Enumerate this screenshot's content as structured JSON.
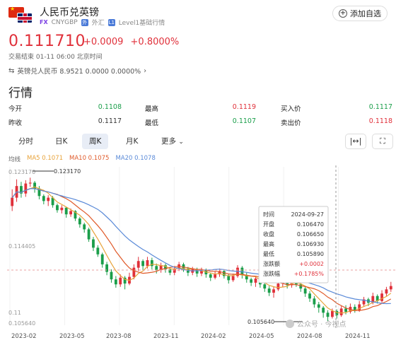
{
  "header": {
    "title": "人民币兑英镑",
    "badge": "FX",
    "code": "CNYGBP",
    "market_icon": "外",
    "market": "外汇",
    "level_icon": "L1",
    "level": "Level1基础行情",
    "add_watchlist": "添加自选"
  },
  "quote": {
    "price": "0.111710",
    "change": "+0.0009",
    "change_pct": "+0.8000%",
    "status": "交易结束 01-11 06:00 北京时间",
    "conversion": "英镑兑人民币 8.9521 0.0000 0.0000%"
  },
  "section_title": "行情",
  "stats": [
    {
      "label": "今开",
      "value": "0.1108",
      "color": "green"
    },
    {
      "label": "最高",
      "value": "0.1119",
      "color": "red"
    },
    {
      "label": "买入价",
      "value": "0.1117",
      "color": "green"
    },
    {
      "label": "昨收",
      "value": "0.1117",
      "color": "neutral"
    },
    {
      "label": "最低",
      "value": "0.1107",
      "color": "green"
    },
    {
      "label": "卖出价",
      "value": "0.1118",
      "color": "red"
    }
  ],
  "tabs": [
    "分时",
    "日K",
    "周K",
    "月K",
    "更多"
  ],
  "active_tab": "周K",
  "ma": {
    "label": "均线",
    "ma5": "MA5 0.1071",
    "ma10": "MA10 0.1075",
    "ma20": "MA20 0.1078"
  },
  "colors": {
    "up": "#e0303a",
    "down": "#1a9e4a",
    "ma5": "#e8a33a",
    "ma10": "#e05a2a",
    "ma20": "#5a8ad8"
  },
  "chart_data": {
    "type": "candlestick",
    "y_ticks": [
      "0.123170",
      "0.114405",
      "0.11",
      "0.105640"
    ],
    "annotations": {
      "high": "0.123170",
      "low": "0.105640"
    },
    "x_ticks": [
      "2023-02",
      "2023-05",
      "2023-08",
      "2023-11",
      "2024-02",
      "2024-05",
      "2024-08",
      "2024-11"
    ],
    "ylim": [
      0.1055,
      0.1245
    ],
    "candles": [
      {
        "o": 0.1198,
        "c": 0.1208,
        "h": 0.1218,
        "l": 0.1192
      },
      {
        "o": 0.1208,
        "c": 0.1222,
        "h": 0.123,
        "l": 0.1203
      },
      {
        "o": 0.1222,
        "c": 0.1213,
        "h": 0.1227,
        "l": 0.1208
      },
      {
        "o": 0.1213,
        "c": 0.1225,
        "h": 0.1229,
        "l": 0.1209
      },
      {
        "o": 0.1225,
        "c": 0.1226,
        "h": 0.1232,
        "l": 0.1221
      },
      {
        "o": 0.1226,
        "c": 0.1219,
        "h": 0.1228,
        "l": 0.1214
      },
      {
        "o": 0.1219,
        "c": 0.121,
        "h": 0.1222,
        "l": 0.1206
      },
      {
        "o": 0.121,
        "c": 0.1204,
        "h": 0.1212,
        "l": 0.12
      },
      {
        "o": 0.1204,
        "c": 0.1208,
        "h": 0.1211,
        "l": 0.1198
      },
      {
        "o": 0.1208,
        "c": 0.1199,
        "h": 0.121,
        "l": 0.1196
      },
      {
        "o": 0.1199,
        "c": 0.1193,
        "h": 0.1201,
        "l": 0.119
      },
      {
        "o": 0.1193,
        "c": 0.1196,
        "h": 0.1199,
        "l": 0.1189
      },
      {
        "o": 0.1196,
        "c": 0.1188,
        "h": 0.1197,
        "l": 0.1184
      },
      {
        "o": 0.1188,
        "c": 0.1192,
        "h": 0.1195,
        "l": 0.1185
      },
      {
        "o": 0.1192,
        "c": 0.1183,
        "h": 0.1193,
        "l": 0.118
      },
      {
        "o": 0.1183,
        "c": 0.1176,
        "h": 0.1185,
        "l": 0.1172
      },
      {
        "o": 0.1176,
        "c": 0.117,
        "h": 0.1178,
        "l": 0.1166
      },
      {
        "o": 0.117,
        "c": 0.1158,
        "h": 0.1172,
        "l": 0.1155
      },
      {
        "o": 0.1158,
        "c": 0.1148,
        "h": 0.1161,
        "l": 0.1144
      },
      {
        "o": 0.1148,
        "c": 0.114,
        "h": 0.1151,
        "l": 0.1137
      },
      {
        "o": 0.114,
        "c": 0.1128,
        "h": 0.1142,
        "l": 0.1124
      },
      {
        "o": 0.1128,
        "c": 0.1119,
        "h": 0.1131,
        "l": 0.1115
      },
      {
        "o": 0.1119,
        "c": 0.111,
        "h": 0.1122,
        "l": 0.1106
      },
      {
        "o": 0.111,
        "c": 0.1104,
        "h": 0.1114,
        "l": 0.11
      },
      {
        "o": 0.1104,
        "c": 0.1112,
        "h": 0.1116,
        "l": 0.1101
      },
      {
        "o": 0.1112,
        "c": 0.1105,
        "h": 0.1114,
        "l": 0.1098
      },
      {
        "o": 0.1105,
        "c": 0.1113,
        "h": 0.1118,
        "l": 0.1103
      },
      {
        "o": 0.1113,
        "c": 0.1124,
        "h": 0.1128,
        "l": 0.111
      },
      {
        "o": 0.1124,
        "c": 0.1132,
        "h": 0.1137,
        "l": 0.112
      },
      {
        "o": 0.1132,
        "c": 0.1126,
        "h": 0.1134,
        "l": 0.1121
      },
      {
        "o": 0.1126,
        "c": 0.1133,
        "h": 0.1137,
        "l": 0.1123
      },
      {
        "o": 0.1133,
        "c": 0.1126,
        "h": 0.1136,
        "l": 0.1122
      },
      {
        "o": 0.1126,
        "c": 0.1121,
        "h": 0.1129,
        "l": 0.1117
      },
      {
        "o": 0.1121,
        "c": 0.1127,
        "h": 0.113,
        "l": 0.1118
      },
      {
        "o": 0.1127,
        "c": 0.1122,
        "h": 0.1129,
        "l": 0.1118
      },
      {
        "o": 0.1122,
        "c": 0.1118,
        "h": 0.1125,
        "l": 0.1115
      },
      {
        "o": 0.1118,
        "c": 0.1123,
        "h": 0.1126,
        "l": 0.1115
      },
      {
        "o": 0.1123,
        "c": 0.1128,
        "h": 0.1131,
        "l": 0.112
      },
      {
        "o": 0.1128,
        "c": 0.1123,
        "h": 0.113,
        "l": 0.1119
      },
      {
        "o": 0.1123,
        "c": 0.1118,
        "h": 0.1125,
        "l": 0.1114
      },
      {
        "o": 0.1118,
        "c": 0.1122,
        "h": 0.1125,
        "l": 0.1115
      },
      {
        "o": 0.1122,
        "c": 0.1117,
        "h": 0.1124,
        "l": 0.1113
      },
      {
        "o": 0.1117,
        "c": 0.1121,
        "h": 0.1124,
        "l": 0.1114
      },
      {
        "o": 0.1121,
        "c": 0.1116,
        "h": 0.1123,
        "l": 0.1112
      },
      {
        "o": 0.1116,
        "c": 0.1112,
        "h": 0.1118,
        "l": 0.1108
      },
      {
        "o": 0.1112,
        "c": 0.1116,
        "h": 0.112,
        "l": 0.111
      },
      {
        "o": 0.1116,
        "c": 0.112,
        "h": 0.1123,
        "l": 0.1113
      },
      {
        "o": 0.112,
        "c": 0.1114,
        "h": 0.1122,
        "l": 0.1111
      },
      {
        "o": 0.1114,
        "c": 0.1109,
        "h": 0.1116,
        "l": 0.1105
      },
      {
        "o": 0.1109,
        "c": 0.1114,
        "h": 0.1117,
        "l": 0.1107
      },
      {
        "o": 0.1114,
        "c": 0.1124,
        "h": 0.1127,
        "l": 0.1112
      },
      {
        "o": 0.1124,
        "c": 0.1115,
        "h": 0.1126,
        "l": 0.1111
      },
      {
        "o": 0.1115,
        "c": 0.111,
        "h": 0.1118,
        "l": 0.1106
      },
      {
        "o": 0.111,
        "c": 0.1106,
        "h": 0.1112,
        "l": 0.1102
      },
      {
        "o": 0.1106,
        "c": 0.1111,
        "h": 0.1114,
        "l": 0.1101
      },
      {
        "o": 0.1111,
        "c": 0.1104,
        "h": 0.1113,
        "l": 0.11
      },
      {
        "o": 0.1104,
        "c": 0.1099,
        "h": 0.1106,
        "l": 0.1095
      },
      {
        "o": 0.1099,
        "c": 0.1094,
        "h": 0.1102,
        "l": 0.109
      },
      {
        "o": 0.1094,
        "c": 0.1098,
        "h": 0.1101,
        "l": 0.1088
      },
      {
        "o": 0.1098,
        "c": 0.1105,
        "h": 0.1108,
        "l": 0.1096
      },
      {
        "o": 0.1105,
        "c": 0.1108,
        "h": 0.1111,
        "l": 0.1101
      },
      {
        "o": 0.1108,
        "c": 0.1103,
        "h": 0.111,
        "l": 0.1099
      },
      {
        "o": 0.1103,
        "c": 0.111,
        "h": 0.1113,
        "l": 0.11
      },
      {
        "o": 0.111,
        "c": 0.1104,
        "h": 0.1112,
        "l": 0.1101
      },
      {
        "o": 0.1104,
        "c": 0.1099,
        "h": 0.1107,
        "l": 0.1095
      },
      {
        "o": 0.1099,
        "c": 0.1093,
        "h": 0.1101,
        "l": 0.1089
      },
      {
        "o": 0.1093,
        "c": 0.1087,
        "h": 0.1096,
        "l": 0.1083
      },
      {
        "o": 0.1087,
        "c": 0.108,
        "h": 0.109,
        "l": 0.1076
      },
      {
        "o": 0.108,
        "c": 0.1076,
        "h": 0.1083,
        "l": 0.107
      },
      {
        "o": 0.1076,
        "c": 0.107,
        "h": 0.1078,
        "l": 0.1064
      },
      {
        "o": 0.107,
        "c": 0.1065,
        "h": 0.1073,
        "l": 0.106
      },
      {
        "o": 0.1065,
        "c": 0.1072,
        "h": 0.1075,
        "l": 0.1063
      },
      {
        "o": 0.1072,
        "c": 0.1067,
        "h": 0.1074,
        "l": 0.1063
      },
      {
        "o": 0.1067,
        "c": 0.1075,
        "h": 0.1078,
        "l": 0.1065
      },
      {
        "o": 0.1075,
        "c": 0.1071,
        "h": 0.1079,
        "l": 0.1068
      },
      {
        "o": 0.1071,
        "c": 0.1077,
        "h": 0.1081,
        "l": 0.1069
      },
      {
        "o": 0.1077,
        "c": 0.1073,
        "h": 0.108,
        "l": 0.107
      },
      {
        "o": 0.1073,
        "c": 0.108,
        "h": 0.1084,
        "l": 0.1071
      },
      {
        "o": 0.108,
        "c": 0.1086,
        "h": 0.1089,
        "l": 0.1077
      },
      {
        "o": 0.1086,
        "c": 0.1082,
        "h": 0.1088,
        "l": 0.1078
      },
      {
        "o": 0.1082,
        "c": 0.109,
        "h": 0.1094,
        "l": 0.108
      },
      {
        "o": 0.109,
        "c": 0.1084,
        "h": 0.1092,
        "l": 0.1081
      },
      {
        "o": 0.1084,
        "c": 0.1093,
        "h": 0.1097,
        "l": 0.1082
      },
      {
        "o": 0.1093,
        "c": 0.1098,
        "h": 0.1101,
        "l": 0.109
      },
      {
        "o": 0.1098,
        "c": 0.1102,
        "h": 0.1107,
        "l": 0.1095
      }
    ]
  },
  "tooltip": {
    "rows": [
      {
        "label": "时间",
        "value": "2024-09-27",
        "color": "neutral"
      },
      {
        "label": "开盘",
        "value": "0.106470",
        "color": "neutral"
      },
      {
        "label": "收盘",
        "value": "0.106650",
        "color": "neutral"
      },
      {
        "label": "最高",
        "value": "0.106930",
        "color": "neutral"
      },
      {
        "label": "最低",
        "value": "0.105890",
        "color": "neutral"
      },
      {
        "label": "涨跌额",
        "value": "+0.0002",
        "color": "red"
      },
      {
        "label": "涨跌幅",
        "value": "+0.1785%",
        "color": "red"
      }
    ]
  },
  "watermark": "公众号 · 今视点"
}
